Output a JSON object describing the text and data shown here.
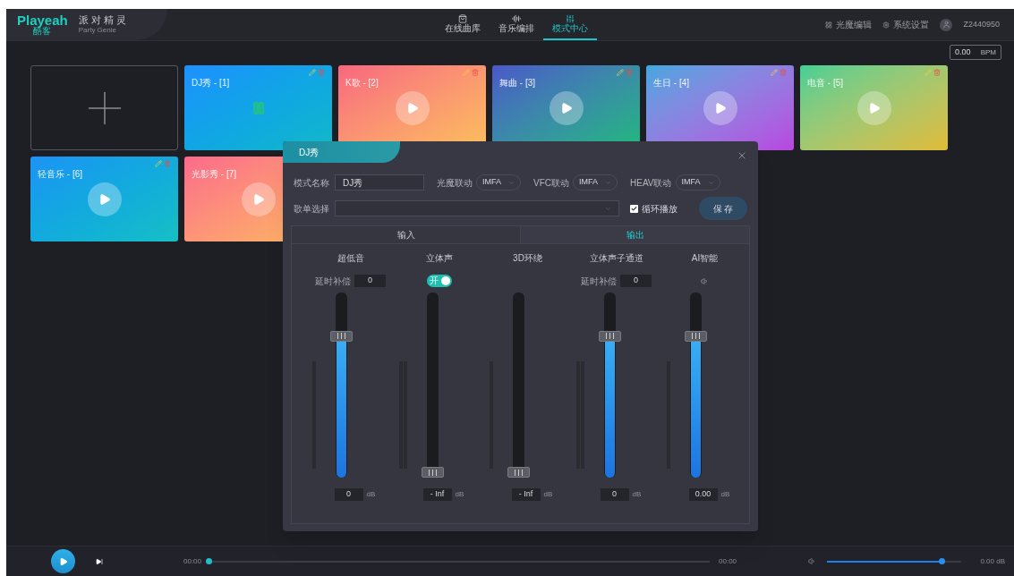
{
  "header": {
    "logo": "Playeah",
    "logo_sub": "酷客",
    "app_name": "派 对 精 灵",
    "app_name_en": "Party Genie",
    "nav": [
      {
        "label": "在线曲库",
        "selected": false
      },
      {
        "label": "音乐编排",
        "selected": false
      },
      {
        "label": "模式中心",
        "selected": true
      }
    ],
    "actions": [
      {
        "label": "光魔编辑"
      },
      {
        "label": "系统设置"
      }
    ],
    "user": "Z2440950"
  },
  "bpm": {
    "value": "0.00",
    "unit": "BPM"
  },
  "modes": [
    {
      "title": "DJ秀 - [1]",
      "playing": true
    },
    {
      "title": "K歌 - [2]",
      "playing": false
    },
    {
      "title": "舞曲 - [3]",
      "playing": false
    },
    {
      "title": "生日 - [4]",
      "playing": false
    },
    {
      "title": "电音 - [5]",
      "playing": false
    },
    {
      "title": "轻音乐 - [6]",
      "playing": false
    },
    {
      "title": "光影秀 - [7]",
      "playing": false
    }
  ],
  "dialog": {
    "title": "DJ秀",
    "name_label": "模式名称",
    "name_value": "DJ秀",
    "links": [
      {
        "label": "光魔联动",
        "value": "IMFA"
      },
      {
        "label": "VFC联动",
        "value": "IMFA"
      },
      {
        "label": "HEAV联动",
        "value": "IMFA"
      }
    ],
    "playlist_label": "歌单选择",
    "loop": {
      "label": "循环播放",
      "checked": true
    },
    "save": "保 存",
    "tabs": [
      {
        "label": "输入",
        "selected": false
      },
      {
        "label": "输出",
        "selected": true
      }
    ],
    "channels": [
      {
        "name": "超低音",
        "kind": "delay",
        "control_label": "延时补偿",
        "control_value": "0",
        "level": 0.78,
        "reading": "0",
        "unit": "dB"
      },
      {
        "name": "立体声",
        "kind": "toggle",
        "toggle_label": "开",
        "on": true,
        "level": 0,
        "reading": "- Inf",
        "unit": "dB"
      },
      {
        "name": "3D环绕",
        "kind": "none",
        "level": 0,
        "reading": "- Inf",
        "unit": "dB"
      },
      {
        "name": "立体声子通道",
        "kind": "delay",
        "control_label": "延时补偿",
        "control_value": "0",
        "level": 0.78,
        "reading": "0",
        "unit": "dB"
      },
      {
        "name": "AI智能",
        "kind": "speaker",
        "level": 0.78,
        "reading": "0.00",
        "unit": "dB"
      }
    ]
  },
  "player": {
    "position": "00:00",
    "duration": "00:00",
    "level": 0,
    "volume": {
      "level": 0.85,
      "reading": "0.00 dB"
    }
  }
}
